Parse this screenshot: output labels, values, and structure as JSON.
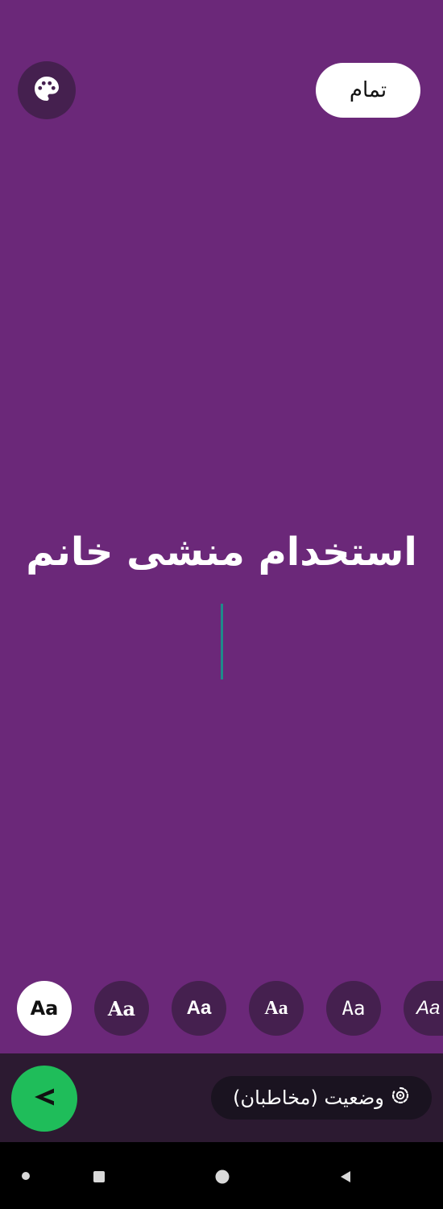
{
  "toolbar": {
    "palette_icon": "palette-icon",
    "done_label": "تمام"
  },
  "editor": {
    "text": "استخدام منشی خانم"
  },
  "font_styles": [
    {
      "label": "Aa",
      "selected": true
    },
    {
      "label": "Aa",
      "selected": false
    },
    {
      "label": "Aa",
      "selected": false
    },
    {
      "label": "Aa",
      "selected": false
    },
    {
      "label": "Aa",
      "selected": false
    },
    {
      "label": "Aa",
      "selected": false
    }
  ],
  "footer": {
    "audience_label": "وضعیت (مخاطبان)",
    "audience_icon": "status-ring-icon",
    "send_icon": "send-arrow-icon"
  },
  "system_nav": {
    "items": [
      "dot-icon",
      "recents-icon",
      "home-icon",
      "back-icon"
    ]
  },
  "colors": {
    "background": "#6b2879",
    "accent_green": "#1fbd5a",
    "caret": "#1f8a8a"
  }
}
